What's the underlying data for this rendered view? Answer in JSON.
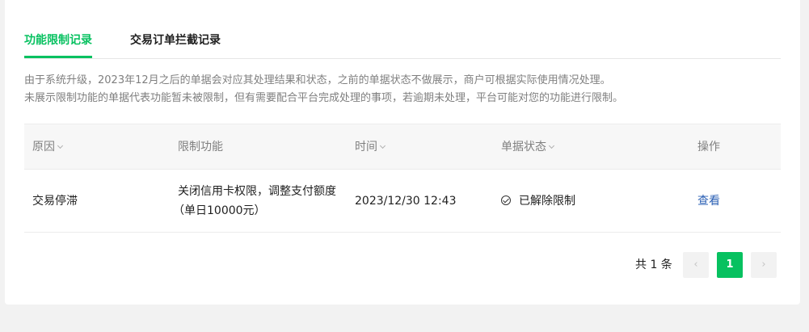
{
  "tabs": [
    {
      "label": "功能限制记录",
      "active": true
    },
    {
      "label": "交易订单拦截记录",
      "active": false
    }
  ],
  "notice": {
    "line1": "由于系统升级，2023年12月之后的单据会对应其处理结果和状态，之前的单据状态不做展示，商户可根据实际使用情况处理。",
    "line2": "未展示限制功能的单据代表功能暂未被限制，但有需要配合平台完成处理的事项，若逾期未处理，平台可能对您的功能进行限制。"
  },
  "table": {
    "columns": {
      "reason": "原因",
      "function": "限制功能",
      "time": "时间",
      "status": "单据状态",
      "action": "操作"
    },
    "rows": [
      {
        "reason": "交易停滞",
        "function_line1": "关闭信用卡权限，调整支付额度",
        "function_line2": "（单日10000元）",
        "time": "2023/12/30 12:43",
        "status": "已解除限制",
        "action": "查看"
      }
    ]
  },
  "pagination": {
    "total": "共 1 条",
    "current": "1",
    "prev_icon": "chevron-left",
    "next_icon": "chevron-right"
  },
  "colors": {
    "accent": "#07c160",
    "link": "#2a5fb4"
  }
}
